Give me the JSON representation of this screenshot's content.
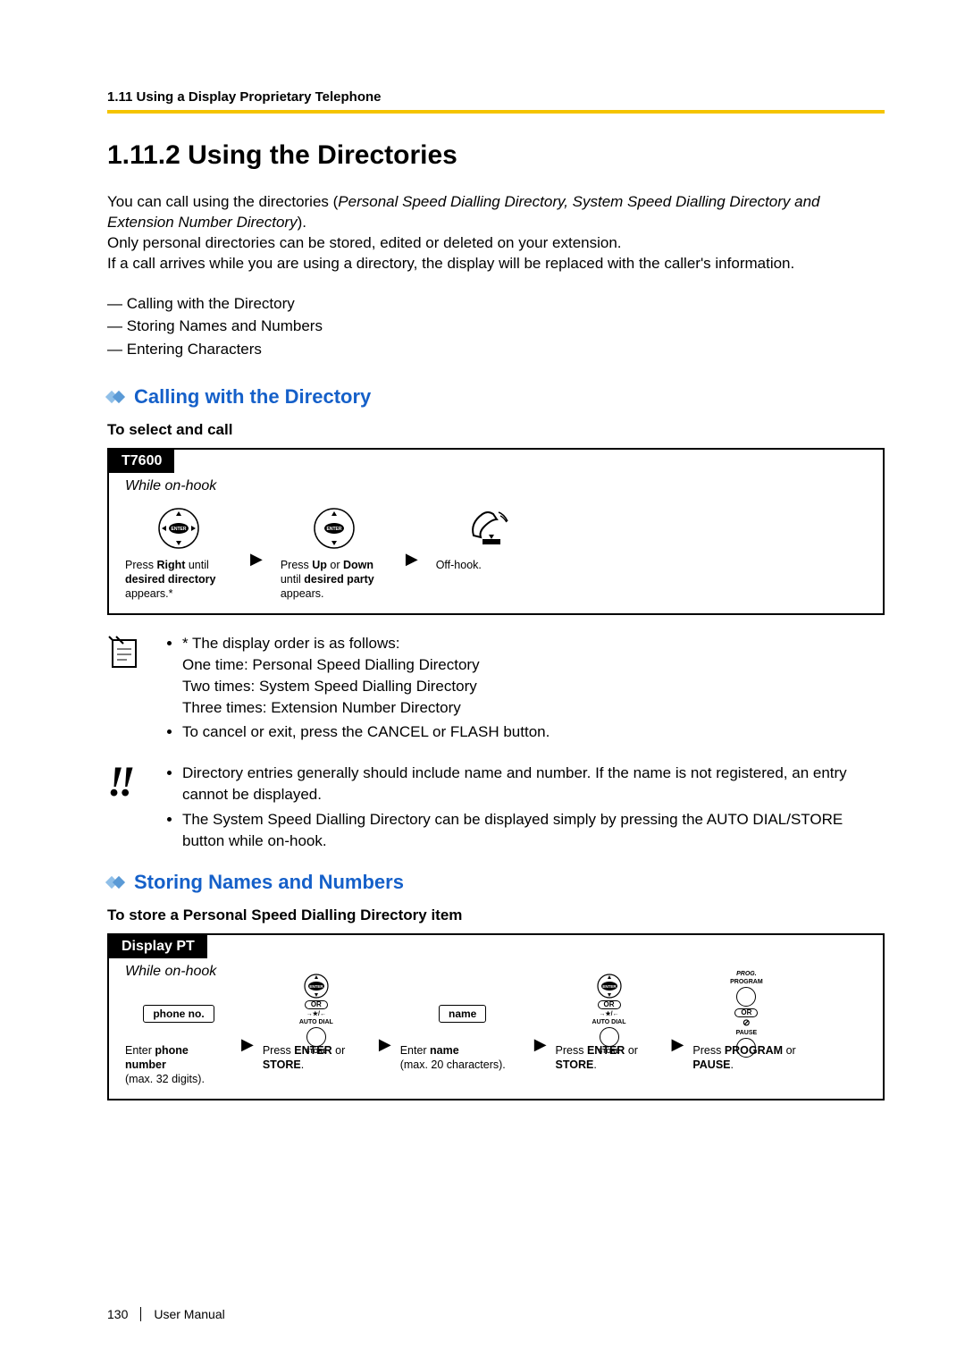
{
  "header": {
    "running": "1.11 Using a Display Proprietary Telephone",
    "title": "1.11.2  Using the Directories"
  },
  "intro": {
    "text1a": "You can call using the directories (",
    "text1b": "Personal Speed Dialling Directory, System Speed Dialling Directory and Extension Number Directory",
    "text1c": ").",
    "text2": "Only personal directories can be stored, edited or deleted on your extension.",
    "text3": "If a call arrives while you are using a directory, the display will be replaced with the caller's information."
  },
  "dash_list": [
    "Calling with the Directory",
    "Storing Names and Numbers",
    "Entering Characters"
  ],
  "section1": {
    "heading": "Calling with the Directory",
    "sub": "To select and call",
    "tab": "T7600",
    "hook": "While on-hook",
    "steps": {
      "s1a": "Press ",
      "s1b": "Right",
      "s1c": " until ",
      "s1d": "desired directory",
      "s1e": " appears.*",
      "s2a": "Press ",
      "s2b": "Up",
      "s2c": " or ",
      "s2d": "Down",
      "s2e": " until ",
      "s2f": "desired party",
      "s2g": " appears.",
      "s3": "Off-hook."
    }
  },
  "notes1": {
    "b1": "* The display order is as follows:",
    "b1a": "One time: Personal Speed Dialling Directory",
    "b1b": "Two times: System Speed Dialling Directory",
    "b1c": "Three times: Extension Number Directory",
    "b2": "To cancel or exit, press the CANCEL or FLASH button."
  },
  "notes2": {
    "b1": "Directory entries generally should include name and number. If the name is not registered, an entry cannot be displayed.",
    "b2": "The System Speed Dialling Directory can be displayed simply by pressing the AUTO DIAL/STORE button while on-hook."
  },
  "section2": {
    "heading": "Storing Names and Numbers",
    "sub": "To store a Personal Speed Dialling Directory item",
    "tab": "Display PT",
    "hook": "While on-hook",
    "steps": {
      "phone_box": "phone no.",
      "name_box": "name",
      "s1a": "Enter ",
      "s1b": "phone number",
      "s1c": " (max. 32 digits).",
      "s2a": "Press ",
      "s2b": "ENTER",
      "s2c": " or ",
      "s2d": "STORE",
      "s2e": ".",
      "s3a": "Enter ",
      "s3b": "name",
      "s3c": " (max. 20 characters).",
      "s4a": "Press ",
      "s4b": "ENTER",
      "s4c": " or ",
      "s4d": "STORE",
      "s4e": ".",
      "s5a": "Press ",
      "s5b": "PROGRAM",
      "s5c": " or ",
      "s5d": "PAUSE",
      "s5e": "."
    },
    "labels": {
      "or": "OR",
      "autodial": "AUTO DIAL",
      "store": "STORE",
      "prog": "PROG.",
      "program": "PROGRAM",
      "pause": "PAUSE",
      "enter": "ENTER"
    }
  },
  "footer": {
    "page": "130",
    "manual": "User Manual"
  }
}
